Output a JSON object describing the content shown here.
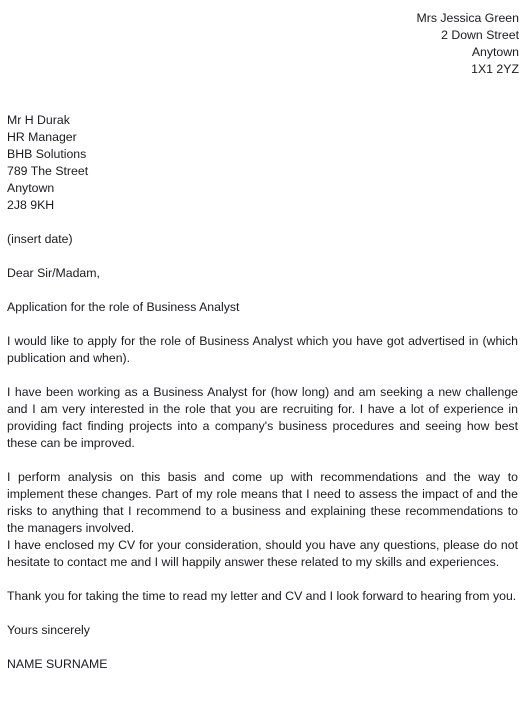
{
  "letter": {
    "sender_address": [
      "Mrs Jessica Green",
      "2 Down Street",
      "Anytown",
      "1X1 2YZ"
    ],
    "recipient_address": [
      "Mr H Durak",
      "HR Manager",
      "BHB Solutions",
      "789 The Street",
      "Anytown",
      "2J8 9KH"
    ],
    "date_line": "(insert date)",
    "salutation": "Dear Sir/Madam,",
    "subject_line": "Application for the role of Business Analyst",
    "paragraphs": [
      "I would like to apply for the role of Business Analyst which you have got advertised in (which publication and when).",
      "I have been working as a Business Analyst for (how long) and am seeking a new challenge and I am very interested in the role that you are recruiting for. I have a lot of experience in providing fact finding projects into a company's business procedures and seeing how best these can be improved.",
      "I perform analysis on this basis and come up with recommendations and the way to implement these changes. Part of my role means that I need to assess the impact of and the risks to anything that I recommend to a business and explaining these recommendations to the managers involved.",
      "I have enclosed my CV for your consideration, should you have any questions, please do not hesitate to contact me and I will happily answer these related to my skills and experiences.",
      "Thank you for taking the time to read my letter and CV and I look forward to hearing from you."
    ],
    "sign_off": "Yours sincerely",
    "signature_name": "NAME SURNAME"
  }
}
